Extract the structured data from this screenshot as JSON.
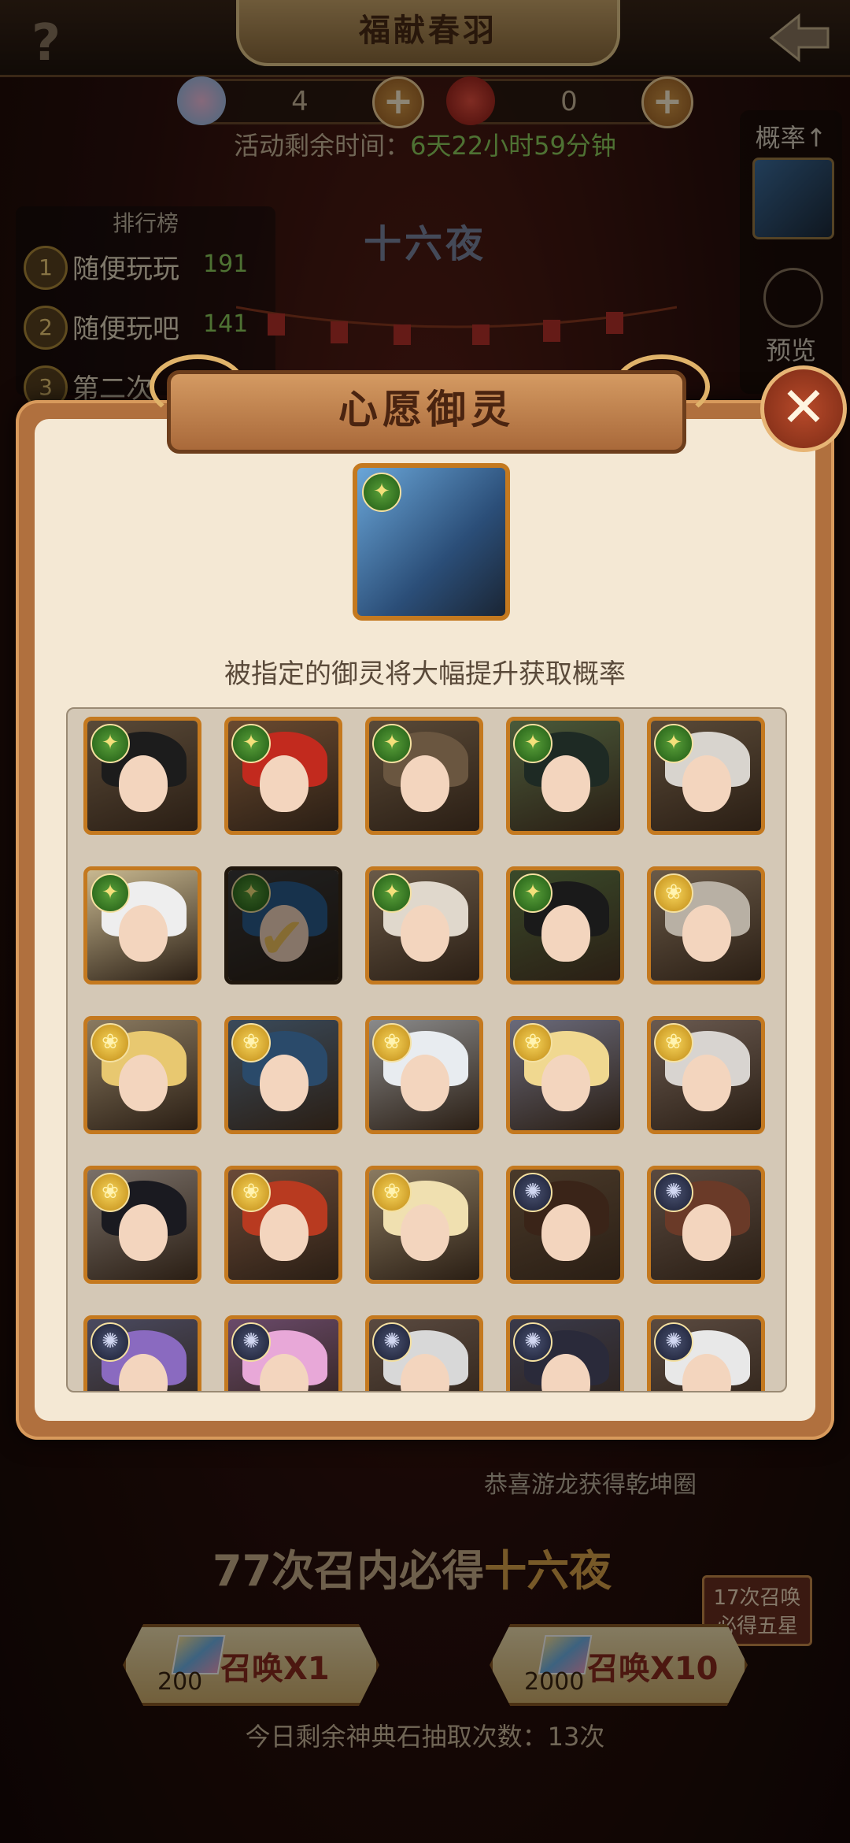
{
  "header": {
    "title": "福献春羽",
    "help_label": "?"
  },
  "currencies": [
    {
      "name": "crystal",
      "value": "4"
    },
    {
      "name": "fortune",
      "value": "0"
    }
  ],
  "event": {
    "timer_label": "活动剩余时间：",
    "timer_value": "6天22小时59分钟",
    "featured_name": "十六夜"
  },
  "ranking": {
    "title": "排行榜",
    "rows": [
      {
        "rank": "1",
        "name": "随便玩玩",
        "score": "191"
      },
      {
        "rank": "2",
        "name": "随便玩吧",
        "score": "141"
      },
      {
        "rank": "3",
        "name": "第二次",
        "score": ""
      }
    ]
  },
  "side": {
    "rate_label": "概率↑",
    "preview_label": "预览"
  },
  "modal": {
    "title": "心愿御灵",
    "close_label": "✕",
    "hint": "被指定的御灵将大幅提升获取概率",
    "cards": [
      {
        "tier": "green",
        "hair": "#1c1c1c",
        "bg": "#5a4a38"
      },
      {
        "tier": "green",
        "hair": "#c22a1e",
        "bg": "#6a4a30"
      },
      {
        "tier": "green",
        "hair": "#6a5640",
        "bg": "#5a4a38"
      },
      {
        "tier": "green",
        "hair": "#1e2a24",
        "bg": "#4a5a3a"
      },
      {
        "tier": "green",
        "hair": "#d8d4ce",
        "bg": "#5a4a38"
      },
      {
        "tier": "green",
        "hair": "#eeeeee",
        "bg": "#c8b890"
      },
      {
        "tier": "green",
        "hair": "#2a5a8a",
        "bg": "#3a3a3a",
        "selected": true
      },
      {
        "tier": "green",
        "hair": "#e0d8cc",
        "bg": "#6a5a48"
      },
      {
        "tier": "green",
        "hair": "#1a1a1a",
        "bg": "#3a4a2a"
      },
      {
        "tier": "gold",
        "hair": "#b8b0a4",
        "bg": "#6a5a48"
      },
      {
        "tier": "gold",
        "hair": "#e8c870",
        "bg": "#8a7a60"
      },
      {
        "tier": "gold",
        "hair": "#2a4a6a",
        "bg": "#3a4a5a"
      },
      {
        "tier": "gold",
        "hair": "#e8ecf0",
        "bg": "#8a8a8a"
      },
      {
        "tier": "gold",
        "hair": "#f0d890",
        "bg": "#6a6a7a"
      },
      {
        "tier": "gold",
        "hair": "#d8d4d0",
        "bg": "#6a5a50"
      },
      {
        "tier": "gold",
        "hair": "#1a1a20",
        "bg": "#7a7068"
      },
      {
        "tier": "gold",
        "hair": "#b83a20",
        "bg": "#6a4a38"
      },
      {
        "tier": "gold",
        "hair": "#f0e0b0",
        "bg": "#8a7a60"
      },
      {
        "tier": "dark",
        "hair": "#3a2418",
        "bg": "#4a3a2a"
      },
      {
        "tier": "dark",
        "hair": "#6a3a28",
        "bg": "#5a4a40"
      },
      {
        "tier": "dark",
        "hair": "#8a6ac0",
        "bg": "#4a4a60"
      },
      {
        "tier": "dark",
        "hair": "#e8a8d8",
        "bg": "#6a4a6a"
      },
      {
        "tier": "dark",
        "hair": "#d8d8d8",
        "bg": "#5a4a40"
      },
      {
        "tier": "dark",
        "hair": "#2a2a3a",
        "bg": "#3a3a4a"
      },
      {
        "tier": "dark",
        "hair": "#e8e8e8",
        "bg": "#5a4a40"
      }
    ]
  },
  "bottom": {
    "notice": "恭喜游龙获得乾坤圈",
    "guarantee_prefix": "77次召内必得",
    "guarantee_name": "十六夜",
    "tag_line1": "17次召唤",
    "tag_line2": "必得五星",
    "summon1": {
      "label": "召唤X1",
      "cost": "200"
    },
    "summon10": {
      "label": "召唤X10",
      "cost": "2000"
    },
    "daily": "今日剩余神典石抽取次数：13次"
  },
  "colors": {
    "green_tier": "#2f7a1e",
    "gold_tier": "#d9a420",
    "dark_tier": "#2a2e48",
    "frame": "#c4791f"
  }
}
